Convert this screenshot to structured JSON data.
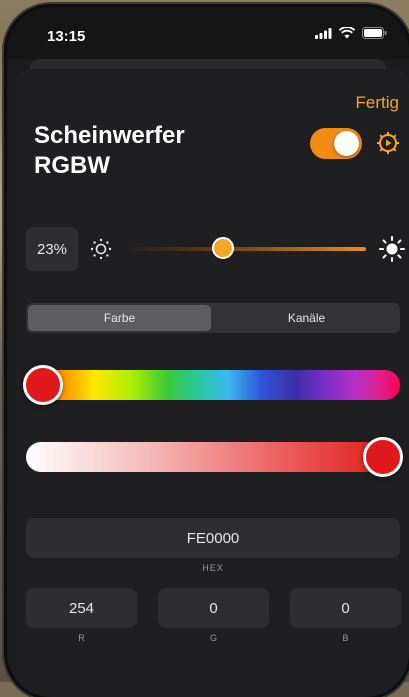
{
  "status_bar": {
    "time": "13:15"
  },
  "sheet": {
    "done_label": "Fertig",
    "title_line1": "Scheinwerfer",
    "title_line2": "RGBW",
    "power_on": true
  },
  "brightness": {
    "value_text": "23%",
    "level": 0.23
  },
  "mode_tabs": [
    {
      "label": "Farbe",
      "active": true
    },
    {
      "label": "Kanäle",
      "active": false
    }
  ],
  "hue_slider": {
    "level": 0.0
  },
  "saturation_slider": {
    "level": 1.0
  },
  "color": {
    "hex_value": "FE0000",
    "hex_label": "HEX",
    "r_value": "254",
    "r_label": "R",
    "g_value": "0",
    "g_label": "G",
    "b_value": "0",
    "b_label": "B"
  },
  "colors": {
    "accent": "#f08c14",
    "selected_color": "#fe0000",
    "background": "#1f1f21"
  },
  "icons": {
    "settings": "gear-play-icon",
    "sun_dim": "sun-dim-icon",
    "sun_bright": "sun-bright-icon"
  }
}
